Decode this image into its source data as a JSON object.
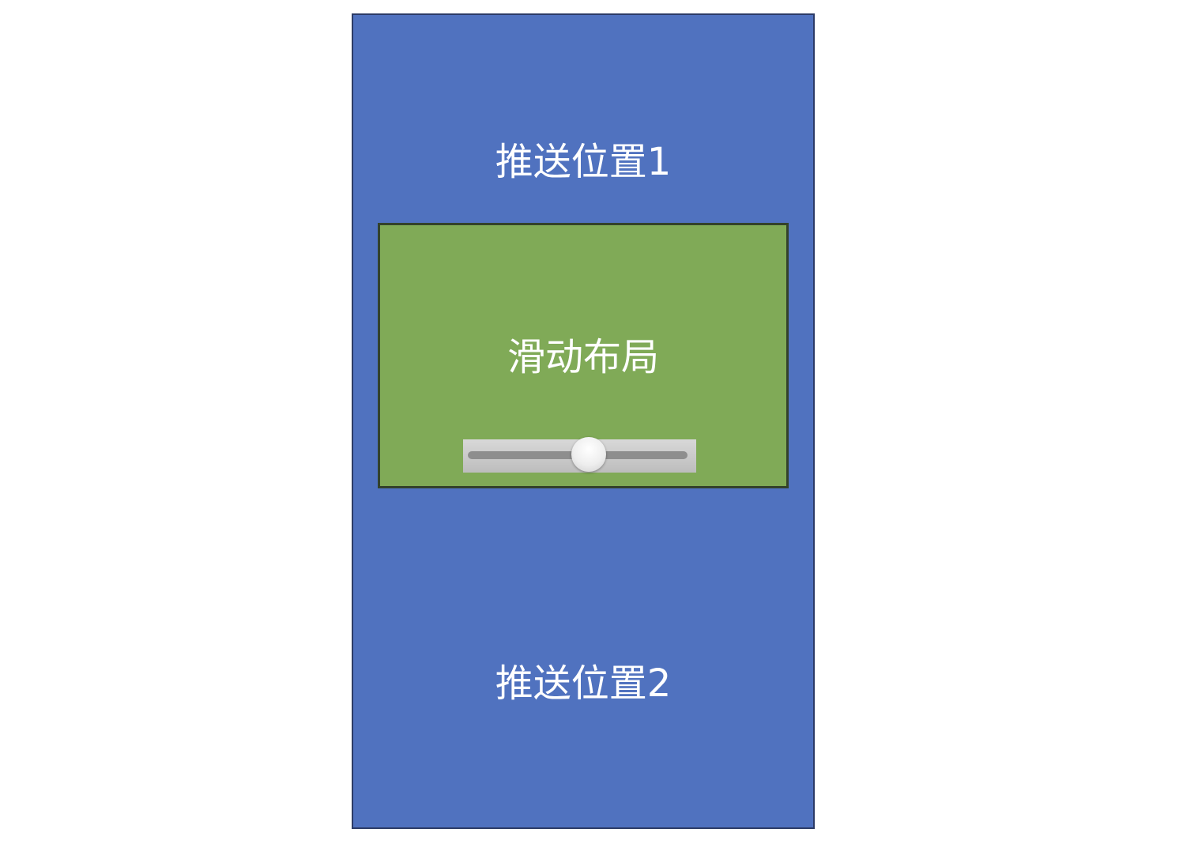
{
  "top_label": "推送位置1",
  "slide_panel": {
    "title": "滑动布局",
    "slider_value": 0.54
  },
  "bottom_label": "推送位置2",
  "colors": {
    "phone_background": "#5072bf",
    "phone_border": "#2c3b66",
    "panel_background": "#80aa57",
    "panel_border": "#33422a",
    "text": "#ffffff"
  }
}
